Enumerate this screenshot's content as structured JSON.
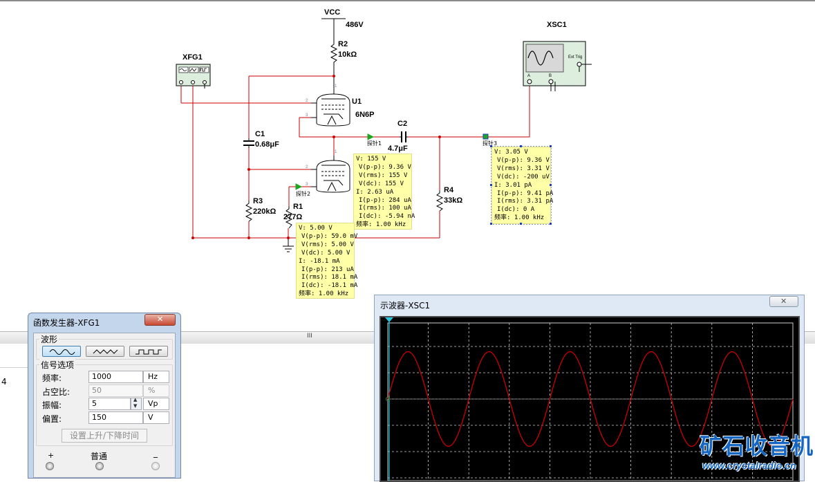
{
  "circuit": {
    "vcc_label": "VCC",
    "vcc_value": "486V",
    "xfg_label": "XFG1",
    "xsc_label": "XSC1",
    "r2_name": "R2",
    "r2_value": "10kΩ",
    "u1_name": "U1",
    "u1_type": "6N6P",
    "c1_name": "C1",
    "c1_value": "0.68μF",
    "c2_name": "C2",
    "c2_value": "4.7μF",
    "r3_name": "R3",
    "r3_value": "220kΩ",
    "r1_name": "R1",
    "r1_value": "277Ω",
    "r4_name": "R4",
    "r4_value": "33kΩ",
    "ext_trig": "Ext Trig",
    "ch_a": "A",
    "ch_b": "B",
    "pins": {
      "p1": "1",
      "p2": "2",
      "p3": "3"
    },
    "probe1_name": "探针1",
    "probe2_name": "探针2",
    "probe3_name": "探针3",
    "colors": {
      "wire": "#cc0000",
      "probe_bg": "#ffffa8",
      "probe_arrow": "#1fa51f"
    }
  },
  "probe1": {
    "lines": [
      "V: 155 V",
      "V(p-p): 9.36 V",
      "V(rms): 155 V",
      "V(dc): 155 V",
      "I: 2.63 uA",
      "I(p-p): 284 uA",
      "I(rms): 100 uA",
      "I(dc): -5.94 nA",
      "频率: 1.00 kHz"
    ]
  },
  "probe2": {
    "lines": [
      "V: 5.00 V",
      "V(p-p): 59.0 mV",
      "V(rms): 5.00 V",
      "V(dc): 5.00 V",
      "I: -18.1 mA",
      "I(p-p): 213 uA",
      "I(rms): 18.1 mA",
      "I(dc): -18.1 mA",
      "频率: 1.00 kHz"
    ]
  },
  "probe3": {
    "lines": [
      "V: 3.05 V",
      "V(p-p): 9.36 V",
      "V(rms): 3.31 V",
      "V(dc): -200 uV",
      "I: 3.01 pA",
      "I(p-p): 9.41 pA",
      "I(rms): 3.31 pA",
      "I(dc): 0 A",
      "频率: 1.00 kHz"
    ]
  },
  "background": {
    "scroll_mark": "III",
    "left_digit": "4"
  },
  "function_generator": {
    "title": "函数发生器-XFG1",
    "close_label": "✕",
    "waveform_group": "波形",
    "waveforms": [
      "sine-wave-icon",
      "triangle-wave-icon",
      "square-wave-icon"
    ],
    "selected_waveform": "sine",
    "signal_group": "信号选项",
    "frequency_label": "频率:",
    "frequency_value": "1000",
    "frequency_unit": "Hz",
    "duty_label": "占空比:",
    "duty_value": "50",
    "duty_unit": "%",
    "amplitude_label": "振幅:",
    "amplitude_value": "5",
    "amplitude_unit": "Vp",
    "offset_label": "偏置:",
    "offset_value": "150",
    "offset_unit": "V",
    "rise_fall_button": "设置上升/下降时间",
    "term_plus": "+",
    "term_common": "普通",
    "term_minus": "_"
  },
  "oscilloscope": {
    "title": "示波器-XSC1",
    "close_label": "✕",
    "trace_color": "#cc0000",
    "grid_color": "#cfcfcf",
    "cursor_color": "#28c4dc",
    "cycles_visible": 5,
    "amplitude_divs": 1.8
  },
  "watermark": {
    "cn": "矿石收音机",
    "url": "www.crystalradio.cn"
  }
}
